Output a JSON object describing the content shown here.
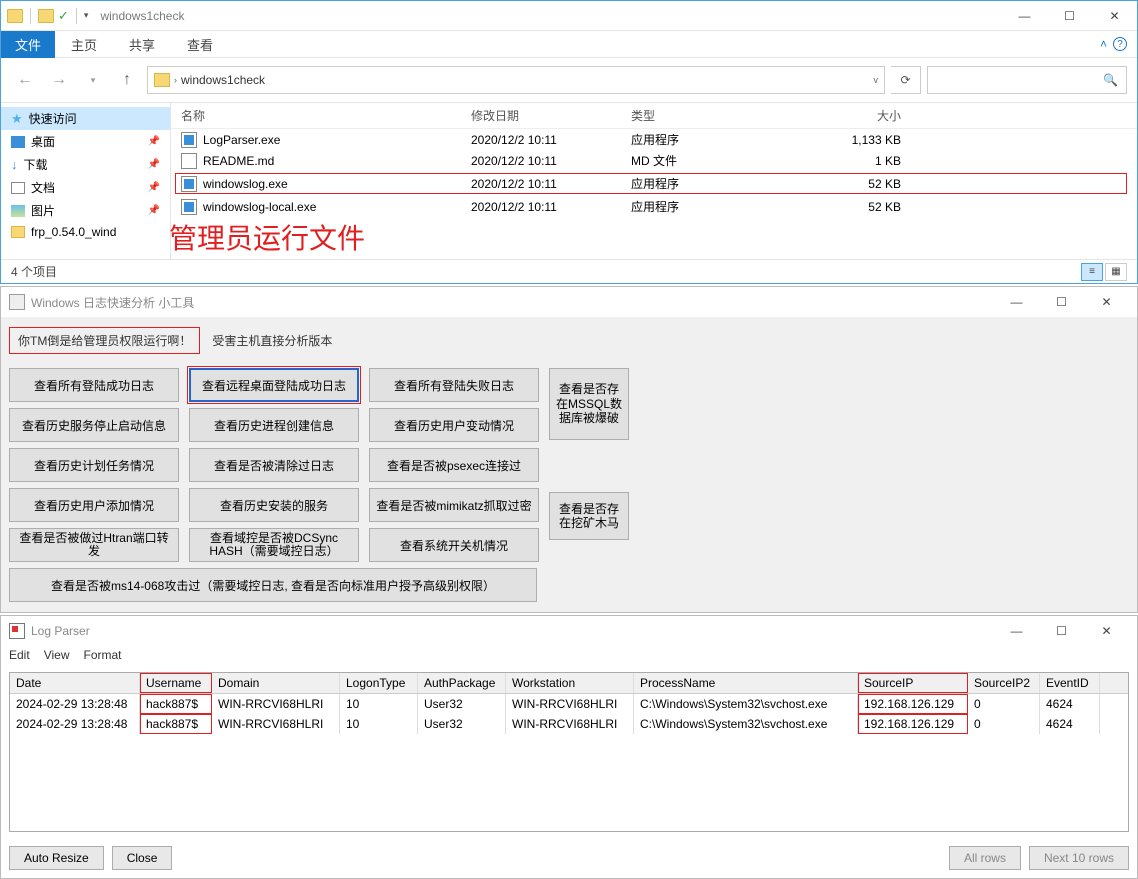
{
  "explorer": {
    "title": "windows1check",
    "tabs": {
      "file": "文件",
      "home": "主页",
      "share": "共享",
      "view": "查看"
    },
    "breadcrumb": "windows1check",
    "search_placeholder": "",
    "sidebar": {
      "quick": "快速访问",
      "items": [
        "桌面",
        "下载",
        "文档",
        "图片",
        "frp_0.54.0_wind"
      ]
    },
    "columns": {
      "name": "名称",
      "date": "修改日期",
      "type": "类型",
      "size": "大小"
    },
    "files": [
      {
        "name": "LogParser.exe",
        "date": "2020/12/2 10:11",
        "type": "应用程序",
        "size": "1,133 KB"
      },
      {
        "name": "README.md",
        "date": "2020/12/2 10:11",
        "type": "MD 文件",
        "size": "1 KB"
      },
      {
        "name": "windowslog.exe",
        "date": "2020/12/2 10:11",
        "type": "应用程序",
        "size": "52 KB"
      },
      {
        "name": "windowslog-local.exe",
        "date": "2020/12/2 10:11",
        "type": "应用程序",
        "size": "52 KB"
      }
    ],
    "status": "4 个项目",
    "overlay": "管理员运行文件"
  },
  "analyzer": {
    "title": "Windows 日志快速分析 小工具",
    "hint_box": "你TM倒是给管理员权限运行啊！",
    "hint_text": "受害主机直接分析版本",
    "buttons": {
      "r0c0": "查看所有登陆成功日志",
      "r0c1": "查看远程桌面登陆成功日志",
      "r0c2": "查看所有登陆失败日志",
      "r1c0": "查看历史服务停止启动信息",
      "r1c1": "查看历史进程创建信息",
      "r1c2": "查看历史用户变动情况",
      "r2c0": "查看历史计划任务情况",
      "r2c1": "查看是否被清除过日志",
      "r2c2": "查看是否被psexec连接过",
      "r3c0": "查看历史用户添加情况",
      "r3c1": "查看历史安装的服务",
      "r3c2": "查看是否被mimikatz抓取过密",
      "r4c0": "查看是否被做过Htran端口转发",
      "r4c1": "查看域控是否被DCSync HASH（需要域控日志）",
      "r4c2": "查看系统开关机情况",
      "side_top": "查看是否存在MSSQL数据库被爆破",
      "side_bot": "查看是否存在挖矿木马",
      "wide": "查看是否被ms14-068攻击过（需要域控日志, 查看是否向标准用户授予高级别权限）"
    }
  },
  "logparser": {
    "title": "Log Parser",
    "menu": {
      "edit": "Edit",
      "view": "View",
      "format": "Format"
    },
    "columns": [
      "Date",
      "Username",
      "Domain",
      "LogonType",
      "AuthPackage",
      "Workstation",
      "ProcessName",
      "SourceIP",
      "SourceIP2",
      "EventID"
    ],
    "rows": [
      {
        "date": "2024-02-29 13:28:48",
        "user": "hack887$",
        "dom": "WIN-RRCVI68HLRI",
        "logon": "10",
        "auth": "User32",
        "ws": "WIN-RRCVI68HLRI",
        "proc": "C:\\Windows\\System32\\svchost.exe",
        "sip": "192.168.126.129",
        "sip2": "0",
        "eid": "4624"
      },
      {
        "date": "2024-02-29 13:28:48",
        "user": "hack887$",
        "dom": "WIN-RRCVI68HLRI",
        "logon": "10",
        "auth": "User32",
        "ws": "WIN-RRCVI68HLRI",
        "proc": "C:\\Windows\\System32\\svchost.exe",
        "sip": "192.168.126.129",
        "sip2": "0",
        "eid": "4624"
      }
    ],
    "footer": {
      "auto": "Auto Resize",
      "close": "Close",
      "all": "All rows",
      "next": "Next 10 rows"
    }
  }
}
